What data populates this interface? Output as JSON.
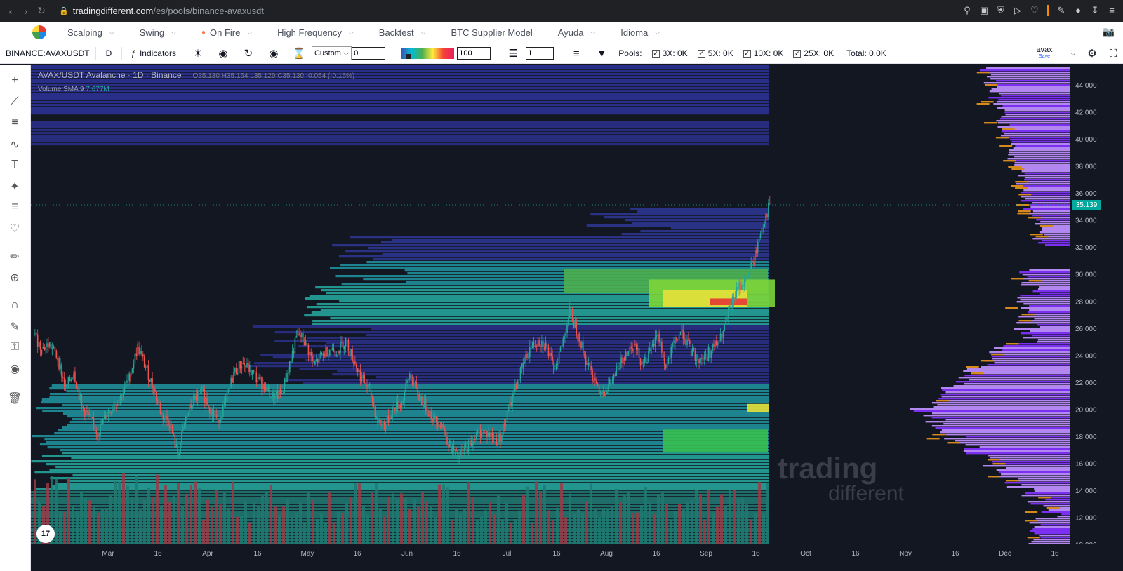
{
  "browser": {
    "url_host": "tradingdifferent.com",
    "url_path": "/es/pools/binance-avaxusdt"
  },
  "nav": {
    "items": [
      {
        "label": "Scalping",
        "dropdown": true
      },
      {
        "label": "Swing",
        "dropdown": true
      },
      {
        "label": "On Fire",
        "dropdown": true
      },
      {
        "label": "High Frequency",
        "dropdown": true
      },
      {
        "label": "Backtest",
        "dropdown": true
      },
      {
        "label": "BTC Supplier Model",
        "dropdown": false
      },
      {
        "label": "Ayuda",
        "dropdown": true
      },
      {
        "label": "Idioma",
        "dropdown": true
      }
    ]
  },
  "toolbar": {
    "symbol": "BINANCE:AVAXUSDT",
    "interval": "D",
    "indicators_label": "Indicators",
    "range_select": "Custom",
    "range_value": "0",
    "color_max": "100",
    "layers_value": "1",
    "pools_label": "Pools:",
    "pools": [
      {
        "label": "3X: 0K",
        "checked": true
      },
      {
        "label": "5X: 0K",
        "checked": true
      },
      {
        "label": "10X: 0K",
        "checked": true
      },
      {
        "label": "25X: 0K",
        "checked": true
      }
    ],
    "total": "Total: 0.0K",
    "user": "avax",
    "save": "Save"
  },
  "chart": {
    "title": "AVAX/USDT Avalanche · 1D · Binance",
    "ohlc": "O35.130 H35.164 L35.129 C35.139 -0.054 (-0.15%)",
    "volume_label": "Volume SMA 9",
    "volume_value": "7.677M",
    "last_price": "35.139",
    "watermark_main": "trading",
    "watermark_sub": "different",
    "tv_logo": "17"
  },
  "chart_data": {
    "type": "heatmap",
    "symbol": "AVAX/USDT",
    "y_ticks": [
      "44.000",
      "42.000",
      "40.000",
      "38.000",
      "36.000",
      "34.000",
      "32.000",
      "30.000",
      "28.000",
      "26.000",
      "24.000",
      "22.000",
      "20.000",
      "18.000",
      "16.000",
      "14.000",
      "12.000",
      "10.000"
    ],
    "ylim": [
      9.7,
      45.5
    ],
    "x_ticks": [
      "Mar",
      "16",
      "Apr",
      "16",
      "May",
      "16",
      "Jun",
      "16",
      "Jul",
      "16",
      "Aug",
      "16",
      "Sep",
      "16",
      "Oct",
      "16",
      "Nov",
      "16",
      "Dec",
      "16"
    ],
    "price_path": [
      [
        0,
        25.6
      ],
      [
        6,
        24.5
      ],
      [
        12,
        24.8
      ],
      [
        18,
        23.8
      ],
      [
        24,
        21.5
      ],
      [
        30,
        22.8
      ],
      [
        36,
        20.2
      ],
      [
        42,
        19.3
      ],
      [
        48,
        18.2
      ],
      [
        54,
        19.5
      ],
      [
        60,
        20.3
      ],
      [
        66,
        21.0
      ],
      [
        72,
        22.5
      ],
      [
        78,
        24.6
      ],
      [
        84,
        23.1
      ],
      [
        90,
        21.5
      ],
      [
        96,
        19.6
      ],
      [
        102,
        19.0
      ],
      [
        108,
        16.6
      ],
      [
        114,
        19.3
      ],
      [
        120,
        20.7
      ],
      [
        126,
        21.3
      ],
      [
        132,
        20.1
      ],
      [
        138,
        19.2
      ],
      [
        144,
        20.5
      ],
      [
        150,
        22.7
      ],
      [
        156,
        23.4
      ],
      [
        162,
        22.9
      ],
      [
        168,
        22.2
      ],
      [
        174,
        21.6
      ],
      [
        180,
        20.8
      ],
      [
        186,
        21.2
      ],
      [
        192,
        23.4
      ],
      [
        198,
        25.6
      ],
      [
        204,
        24.9
      ],
      [
        210,
        23.3
      ],
      [
        216,
        24.0
      ],
      [
        222,
        24.5
      ],
      [
        228,
        24.3
      ],
      [
        234,
        25.1
      ],
      [
        240,
        23.6
      ],
      [
        246,
        22.3
      ],
      [
        252,
        21.4
      ],
      [
        258,
        19.0
      ],
      [
        264,
        18.9
      ],
      [
        270,
        20.1
      ],
      [
        276,
        20.5
      ],
      [
        282,
        22.6
      ],
      [
        288,
        21.1
      ],
      [
        294,
        20.2
      ],
      [
        300,
        19.3
      ],
      [
        306,
        18.9
      ],
      [
        312,
        17.3
      ],
      [
        318,
        16.4
      ],
      [
        324,
        17.1
      ],
      [
        330,
        17.8
      ],
      [
        336,
        18.4
      ],
      [
        342,
        18.1
      ],
      [
        348,
        17.6
      ],
      [
        354,
        19.1
      ],
      [
        360,
        21.3
      ],
      [
        366,
        23.0
      ],
      [
        372,
        24.5
      ],
      [
        378,
        25.1
      ],
      [
        384,
        24.8
      ],
      [
        390,
        22.9
      ],
      [
        396,
        24.7
      ],
      [
        402,
        27.3
      ],
      [
        408,
        25.6
      ],
      [
        414,
        23.6
      ],
      [
        420,
        22.3
      ],
      [
        426,
        21.2
      ],
      [
        432,
        21.8
      ],
      [
        438,
        23.0
      ],
      [
        444,
        24.3
      ],
      [
        450,
        24.8
      ],
      [
        456,
        23.5
      ],
      [
        462,
        24.1
      ],
      [
        468,
        25.6
      ],
      [
        474,
        23.0
      ],
      [
        480,
        24.8
      ],
      [
        486,
        25.9
      ],
      [
        492,
        24.4
      ],
      [
        498,
        23.7
      ],
      [
        504,
        23.9
      ],
      [
        510,
        24.6
      ],
      [
        516,
        25.3
      ],
      [
        522,
        27.4
      ],
      [
        528,
        28.9
      ],
      [
        534,
        29.6
      ],
      [
        540,
        31.0
      ],
      [
        546,
        33.5
      ],
      [
        552,
        35.139
      ]
    ]
  }
}
